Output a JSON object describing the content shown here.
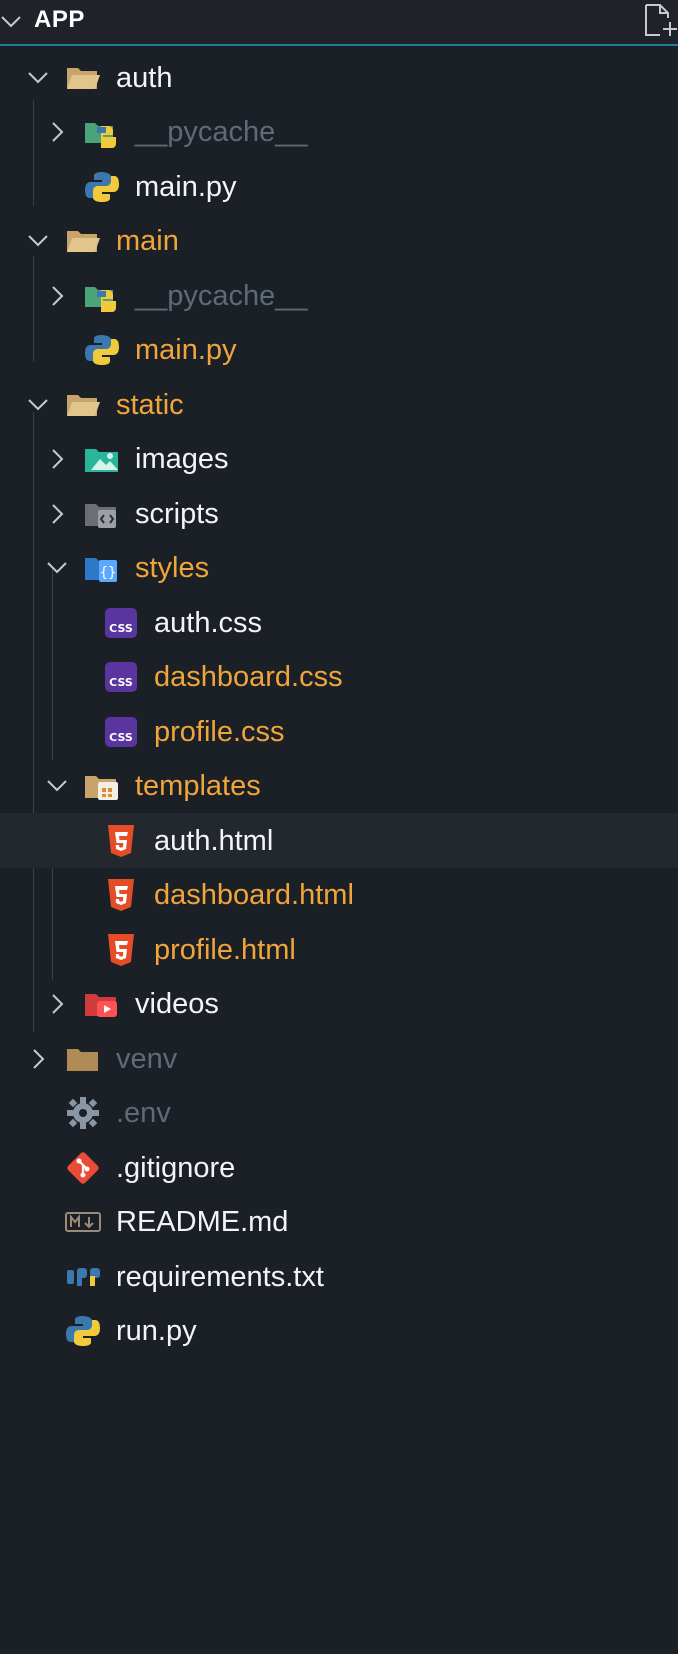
{
  "header": {
    "title": "APP",
    "new_file_icon": "new-file-icon"
  },
  "colors": {
    "accent": "#1f7ea0",
    "modified": "#f0a53a",
    "ignored": "#5d6a78",
    "normal": "#f2f4f7"
  },
  "tree": [
    {
      "label": "auth",
      "icon": "folder-open-icon",
      "twisty": "expanded",
      "state": "normal"
    },
    {
      "label": "__pycache__",
      "icon": "python-folder-icon",
      "twisty": "collapsed",
      "state": "ignored"
    },
    {
      "label": "main.py",
      "icon": "python-icon",
      "twisty": "none",
      "state": "normal"
    },
    {
      "label": "main",
      "icon": "folder-open-icon",
      "twisty": "expanded",
      "state": "modified"
    },
    {
      "label": "__pycache__",
      "icon": "python-folder-icon",
      "twisty": "collapsed",
      "state": "ignored"
    },
    {
      "label": "main.py",
      "icon": "python-icon",
      "twisty": "none",
      "state": "modified"
    },
    {
      "label": "static",
      "icon": "folder-open-icon",
      "twisty": "expanded",
      "state": "modified"
    },
    {
      "label": "images",
      "icon": "images-folder-icon",
      "twisty": "collapsed",
      "state": "normal"
    },
    {
      "label": "scripts",
      "icon": "scripts-folder-icon",
      "twisty": "collapsed",
      "state": "normal"
    },
    {
      "label": "styles",
      "icon": "styles-folder-icon",
      "twisty": "expanded",
      "state": "modified"
    },
    {
      "label": "auth.css",
      "icon": "css-icon",
      "twisty": "none",
      "state": "normal"
    },
    {
      "label": "dashboard.css",
      "icon": "css-icon",
      "twisty": "none",
      "state": "modified"
    },
    {
      "label": "profile.css",
      "icon": "css-icon",
      "twisty": "none",
      "state": "modified"
    },
    {
      "label": "templates",
      "icon": "templates-folder-icon",
      "twisty": "expanded",
      "state": "modified"
    },
    {
      "label": "auth.html",
      "icon": "html5-icon",
      "twisty": "none",
      "state": "normal",
      "selected": true
    },
    {
      "label": "dashboard.html",
      "icon": "html5-icon",
      "twisty": "none",
      "state": "modified"
    },
    {
      "label": "profile.html",
      "icon": "html5-icon",
      "twisty": "none",
      "state": "modified"
    },
    {
      "label": "videos",
      "icon": "videos-folder-icon",
      "twisty": "collapsed",
      "state": "normal"
    },
    {
      "label": "venv",
      "icon": "folder-closed-icon",
      "twisty": "collapsed",
      "state": "ignored"
    },
    {
      "label": ".env",
      "icon": "gear-icon",
      "twisty": "none",
      "state": "ignored"
    },
    {
      "label": ".gitignore",
      "icon": "git-icon",
      "twisty": "none",
      "state": "normal"
    },
    {
      "label": "README.md",
      "icon": "markdown-icon",
      "twisty": "none",
      "state": "normal"
    },
    {
      "label": "requirements.txt",
      "icon": "pip-requirements-icon",
      "twisty": "none",
      "state": "normal"
    },
    {
      "label": "run.py",
      "icon": "python-icon",
      "twisty": "none",
      "state": "normal"
    }
  ]
}
